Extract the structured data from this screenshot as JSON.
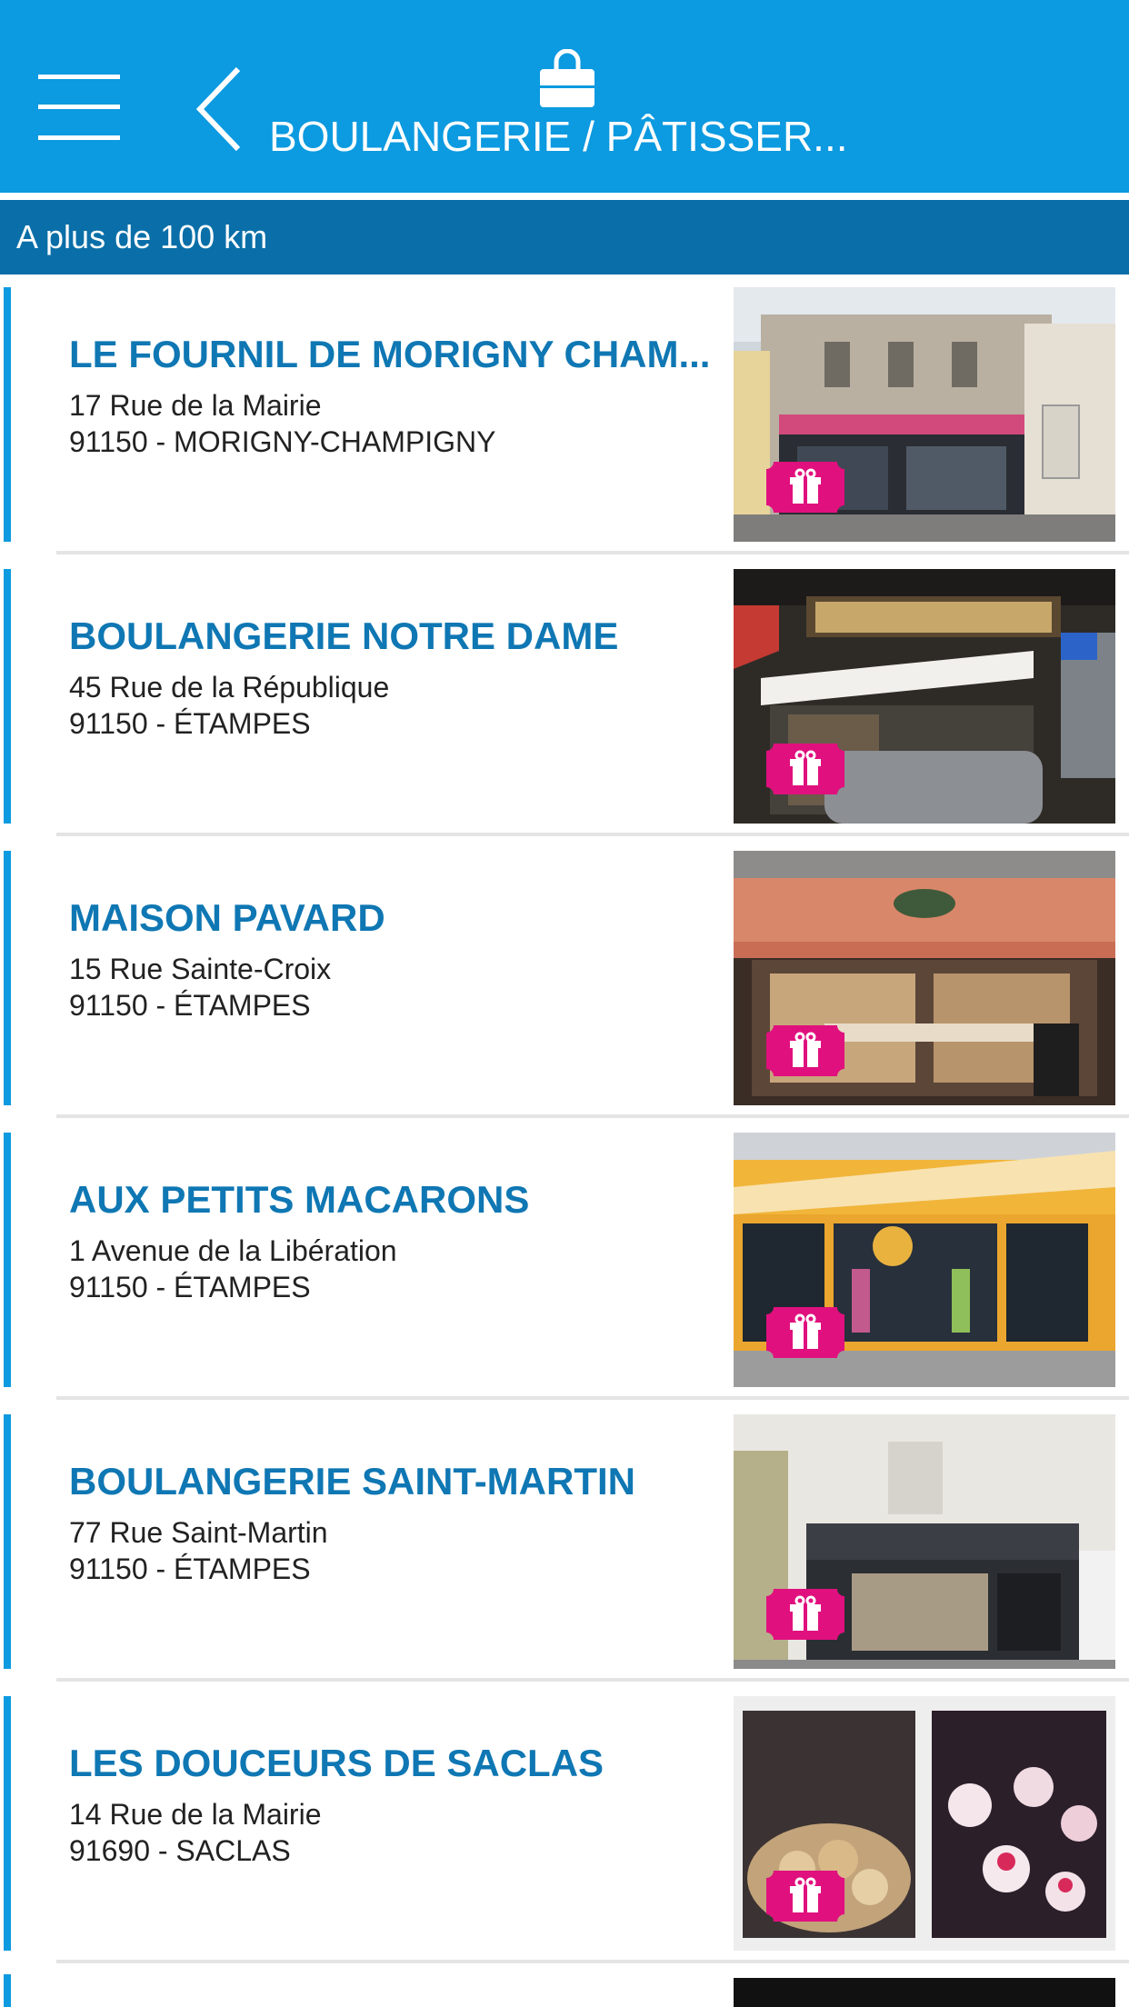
{
  "header": {
    "title": "BOULANGERIE / PÂTISSER...",
    "icons": [
      "menu-icon",
      "back-icon",
      "shopping-bag-icon"
    ],
    "background_color": "#0c9ae0"
  },
  "distance_bar": {
    "label": "A plus de 100 km",
    "background_color": "#0a6fa8"
  },
  "shops": [
    {
      "name": "LE FOURNIL DE MORIGNY CHAM...",
      "street": "17 Rue de la Mairie",
      "city": "91150 - MORIGNY-CHAMPIGNY",
      "has_gift": true
    },
    {
      "name": "BOULANGERIE NOTRE DAME",
      "street": "45 Rue de la République",
      "city": "91150 - ÉTAMPES",
      "has_gift": true
    },
    {
      "name": "MAISON PAVARD",
      "street": "15 Rue Sainte-Croix",
      "city": "91150 - ÉTAMPES",
      "has_gift": true
    },
    {
      "name": "AUX PETITS MACARONS",
      "street": "1 Avenue de la Libération",
      "city": "91150 - ÉTAMPES",
      "has_gift": true
    },
    {
      "name": "BOULANGERIE SAINT-MARTIN",
      "street": "77 Rue Saint-Martin",
      "city": "91150 - ÉTAMPES",
      "has_gift": true
    },
    {
      "name": "LES DOUCEURS DE SACLAS",
      "street": "14 Rue de la Mairie",
      "city": "91690 - SACLAS",
      "has_gift": true
    }
  ],
  "colors": {
    "shop_name": "#0f77b3",
    "accent": "#0c9ae0",
    "gift_badge": "#e0107e"
  }
}
